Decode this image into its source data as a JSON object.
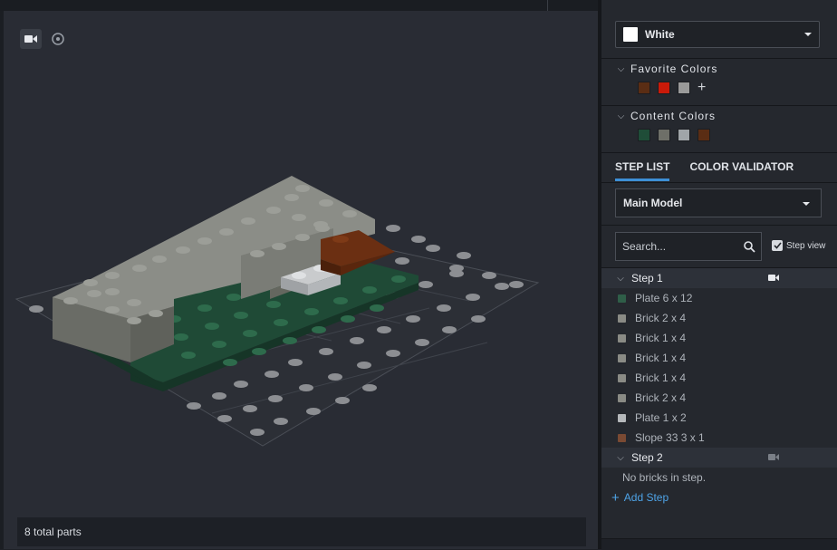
{
  "viewport": {
    "camera_icon": "video-camera-icon",
    "rotate_icon": "rotate-icon",
    "status": "8 total parts"
  },
  "panel": {
    "current_color": {
      "label": "White",
      "hex": "#ffffff"
    },
    "favorite_colors": {
      "title": "Favorite Colors",
      "swatches": [
        "#5a2d14",
        "#c91a09",
        "#9a9a9a"
      ]
    },
    "content_colors": {
      "title": "Content Colors",
      "swatches": [
        "#1f4d38",
        "#6e6f68",
        "#a0a5a9",
        "#5a2d14"
      ]
    },
    "tabs": [
      "STEP LIST",
      "COLOR VALIDATOR"
    ],
    "model_select": "Main Model",
    "search_placeholder": "Search...",
    "step_view_label": "Step view",
    "steps": [
      {
        "title": "Step 1",
        "parts": [
          {
            "name": "Plate 6 x 12",
            "color": "#2f5e48"
          },
          {
            "name": "Brick 2 x 4",
            "color": "#8a8b85"
          },
          {
            "name": "Brick 1 x 4",
            "color": "#8a8b85"
          },
          {
            "name": "Brick 1 x 4",
            "color": "#8a8b85"
          },
          {
            "name": "Brick 1 x 4",
            "color": "#8a8b85"
          },
          {
            "name": "Brick 2 x 4",
            "color": "#8a8b85"
          },
          {
            "name": "Plate 1 x 2",
            "color": "#b5b8bb"
          },
          {
            "name": "Slope 33 3 x 1",
            "color": "#7a4a33"
          }
        ]
      },
      {
        "title": "Step 2",
        "empty_text": "No bricks in step."
      }
    ],
    "add_step": "Add Step"
  }
}
